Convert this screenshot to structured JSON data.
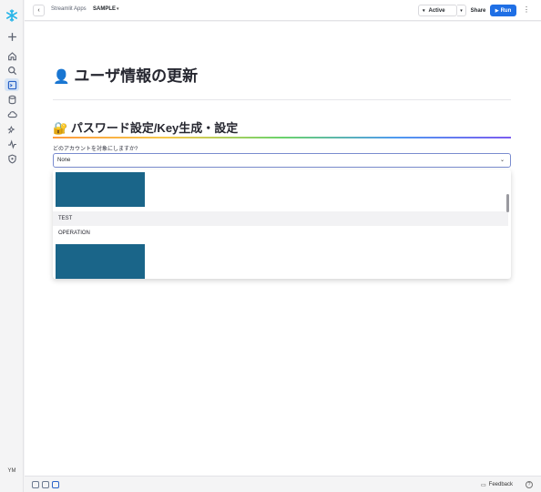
{
  "sidebar": {
    "logo": "snowflake-icon",
    "items": [
      {
        "icon": "plus-icon"
      },
      {
        "icon": "home-icon"
      },
      {
        "icon": "search-icon"
      },
      {
        "icon": "projects-icon",
        "active": true
      },
      {
        "icon": "data-icon"
      },
      {
        "icon": "cloud-icon"
      },
      {
        "icon": "ai-icon"
      },
      {
        "icon": "activity-icon"
      },
      {
        "icon": "shield-icon"
      }
    ],
    "avatar": "YM"
  },
  "topbar": {
    "breadcrumb_parent": "Streamlit Apps",
    "breadcrumb_current": "SAMPLE",
    "status": "Active",
    "share_label": "Share",
    "run_label": "Run"
  },
  "main": {
    "title_emoji": "👤",
    "title": "ユーザ情報の更新",
    "subtitle_emoji": "🔐",
    "subtitle": "パスワード設定/Key生成・設定",
    "select_label": "どのアカウントを対象にしますか?",
    "select_value": "None",
    "options": [
      "TEST",
      "OPERATION"
    ]
  },
  "bottombar": {
    "feedback_label": "Feedback",
    "help_label": "?"
  },
  "colors": {
    "run_button": "#1f6fe5",
    "redacted_block": "#1a6589"
  }
}
